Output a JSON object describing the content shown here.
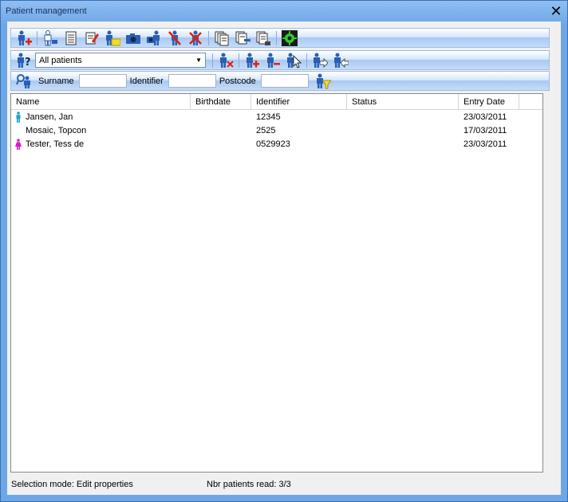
{
  "window": {
    "title": "Patient management",
    "close_glyph": "✕"
  },
  "toolbar1": {
    "buttons": [
      {
        "icon": "add-patient-icon"
      },
      {
        "icon": "patient-list-icon"
      },
      {
        "icon": "document-icon"
      },
      {
        "icon": "edit-icon"
      },
      {
        "icon": "patient-folder-icon"
      },
      {
        "icon": "camera-icon"
      },
      {
        "icon": "patient-camera-icon"
      },
      {
        "icon": "patient-delete-icon"
      },
      {
        "icon": "patient-remove-icon"
      },
      {
        "icon": "export-icon"
      },
      {
        "icon": "import-icon"
      },
      {
        "icon": "report-icon"
      },
      {
        "icon": "settings-gear-icon"
      }
    ]
  },
  "toolbar2": {
    "filter_selected": "All patients"
  },
  "search": {
    "surname_label": "Surname",
    "identifier_label": "Identifier",
    "postcode_label": "Postcode",
    "surname_value": "",
    "identifier_value": "",
    "postcode_value": ""
  },
  "table": {
    "columns": [
      "Name",
      "Birthdate",
      "Identifier",
      "Status",
      "Entry Date"
    ],
    "rows": [
      {
        "gender": "male",
        "name": "Jansen, Jan",
        "birthdate": "",
        "identifier": "12345",
        "status": "",
        "entry_date": "23/03/2011"
      },
      {
        "gender": "none",
        "name": "Mosaic, Topcon",
        "birthdate": "",
        "identifier": "2525",
        "status": "",
        "entry_date": "17/03/2011"
      },
      {
        "gender": "female",
        "name": "Tester, Tess de",
        "birthdate": "",
        "identifier": "0529923",
        "status": "",
        "entry_date": "23/03/2011"
      }
    ]
  },
  "statusbar": {
    "mode": "Selection mode: Edit properties",
    "count": "Nbr patients read: 3/3"
  },
  "colors": {
    "male": "#1c9ed8",
    "female": "#d81cc4",
    "person": "#2a5fb4"
  }
}
